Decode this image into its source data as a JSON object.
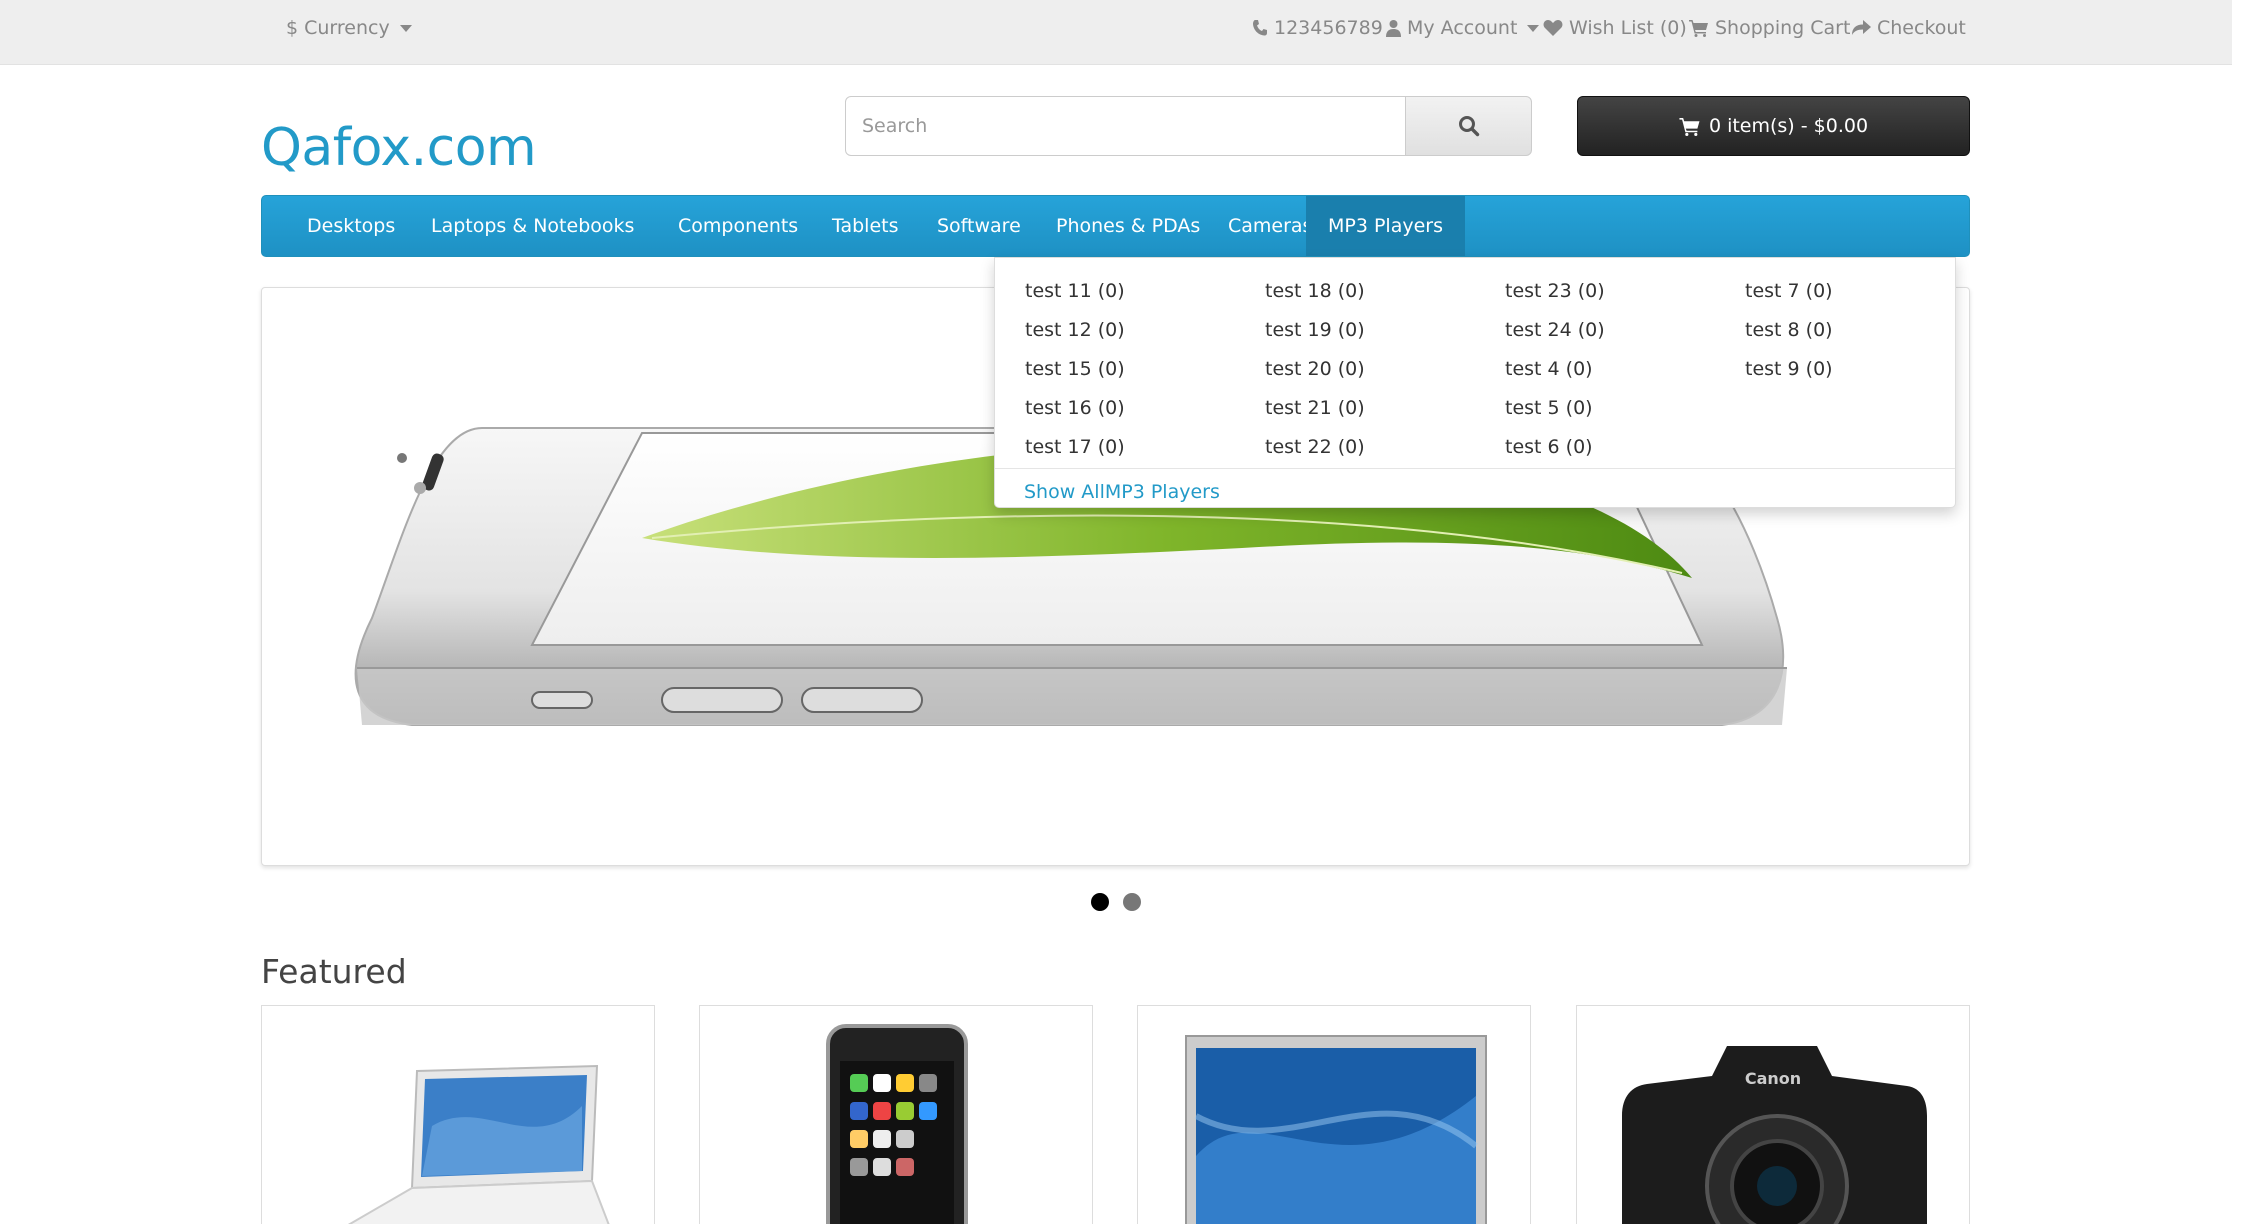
{
  "topbar": {
    "currency": "$ Currency",
    "phone": "123456789",
    "my_account": "My Account",
    "wish_list": "Wish List (0)",
    "shopping_cart": "Shopping Cart",
    "checkout": "Checkout"
  },
  "header": {
    "logo": "Qafox.com",
    "search_placeholder": "Search",
    "cart_label": "0 item(s) - $0.00"
  },
  "nav": {
    "items": [
      "Desktops",
      "Laptops & Notebooks",
      "Components",
      "Tablets",
      "Software",
      "Phones & PDAs",
      "Cameras",
      "MP3 Players"
    ],
    "active": "MP3 Players"
  },
  "dropdown": {
    "columns": [
      [
        "test 11 (0)",
        "test 12 (0)",
        "test 15 (0)",
        "test 16 (0)",
        "test 17 (0)"
      ],
      [
        "test 18 (0)",
        "test 19 (0)",
        "test 20 (0)",
        "test 21 (0)",
        "test 22 (0)"
      ],
      [
        "test 23 (0)",
        "test 24 (0)",
        "test 4 (0)",
        "test 5 (0)",
        "test 6 (0)"
      ],
      [
        "test 7 (0)",
        "test 8 (0)",
        "test 9 (0)"
      ]
    ],
    "show_all": "Show AllMP3 Players"
  },
  "slider": {
    "slides_count": 2,
    "active_slide": 1
  },
  "featured": {
    "title": "Featured",
    "products": [
      "laptop-image",
      "phone-image",
      "monitor-image",
      "camera-image"
    ]
  },
  "colors": {
    "brand": "#229ac8",
    "nav_bg": "#229ac8",
    "cart_bg": "#303030"
  }
}
